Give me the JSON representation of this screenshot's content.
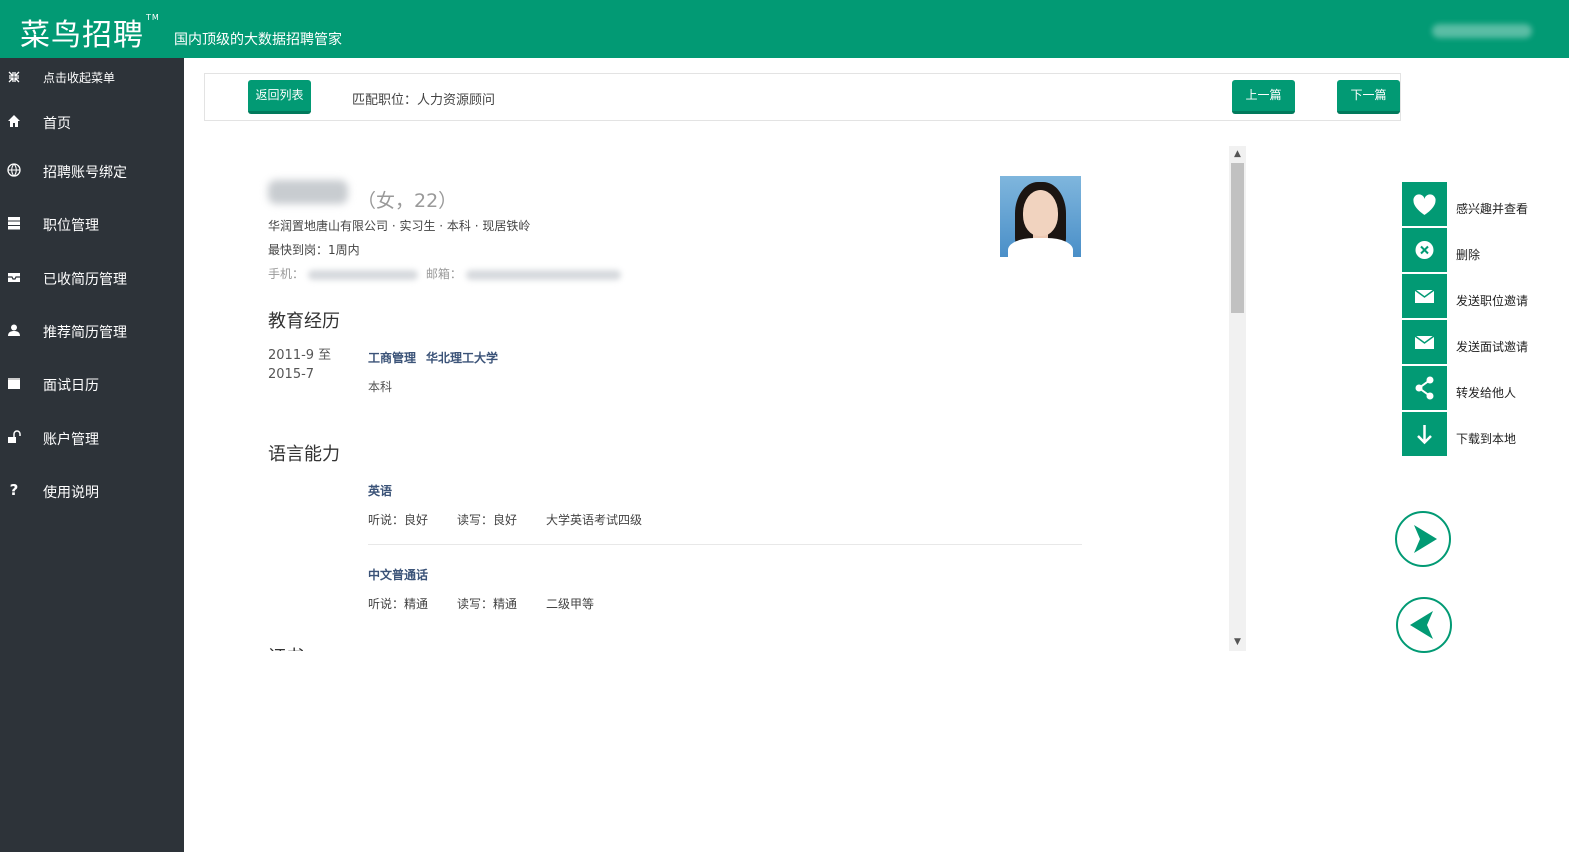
{
  "app": {
    "logo": "菜鸟招聘",
    "tm": "TM",
    "slogan": "国内顶级的大数据招聘管家"
  },
  "sidebar": {
    "items": [
      {
        "label": "点击收起菜单",
        "icon": "collapse-icon"
      },
      {
        "label": "首页",
        "icon": "home-icon"
      },
      {
        "label": "招聘账号绑定",
        "icon": "globe-icon"
      },
      {
        "label": "职位管理",
        "icon": "server-icon"
      },
      {
        "label": "已收简历管理",
        "icon": "inbox-icon"
      },
      {
        "label": "推荐简历管理",
        "icon": "user-icon"
      },
      {
        "label": "面试日历",
        "icon": "calendar-icon"
      },
      {
        "label": "账户管理",
        "icon": "unlock-icon"
      },
      {
        "label": "使用说明",
        "icon": "question-icon"
      }
    ]
  },
  "header": {
    "back_label": "返回列表",
    "match_label": "匹配职位：人力资源顾问",
    "prev_label": "上一篇",
    "next_label": "下一篇"
  },
  "resume": {
    "gender_age": "（女，22）",
    "company_line": "华润置地唐山有限公司 · 实习生 · 本科 · 现居铁岭",
    "availability": "最快到岗：1周内",
    "phone_label": "手机：",
    "email_label": "邮箱：",
    "education_title": "教育经历",
    "education": {
      "date_start": "2011-9 至",
      "date_end": "2015-7",
      "major": "工商管理",
      "school": "华北理工大学",
      "degree": "本科"
    },
    "language_title": "语言能力",
    "languages": [
      {
        "name": "英语",
        "listen": "听说：良好",
        "write": "读写：良好",
        "cert": "大学英语考试四级"
      },
      {
        "name": "中文普通话",
        "listen": "听说：精通",
        "write": "读写：精通",
        "cert": "二级甲等"
      }
    ],
    "next_section_partial": "证书"
  },
  "actions": [
    {
      "label": "感兴趣并查看",
      "icon": "heart-icon"
    },
    {
      "label": "删除",
      "icon": "close-circle-icon"
    },
    {
      "label": "发送职位邀请",
      "icon": "envelope-icon"
    },
    {
      "label": "发送面试邀请",
      "icon": "envelope-icon"
    },
    {
      "label": "转发给他人",
      "icon": "share-icon"
    },
    {
      "label": "下载到本地",
      "icon": "arrow-down-icon"
    }
  ],
  "colors": {
    "brand": "#029a74",
    "sidebar": "#2d3339"
  }
}
